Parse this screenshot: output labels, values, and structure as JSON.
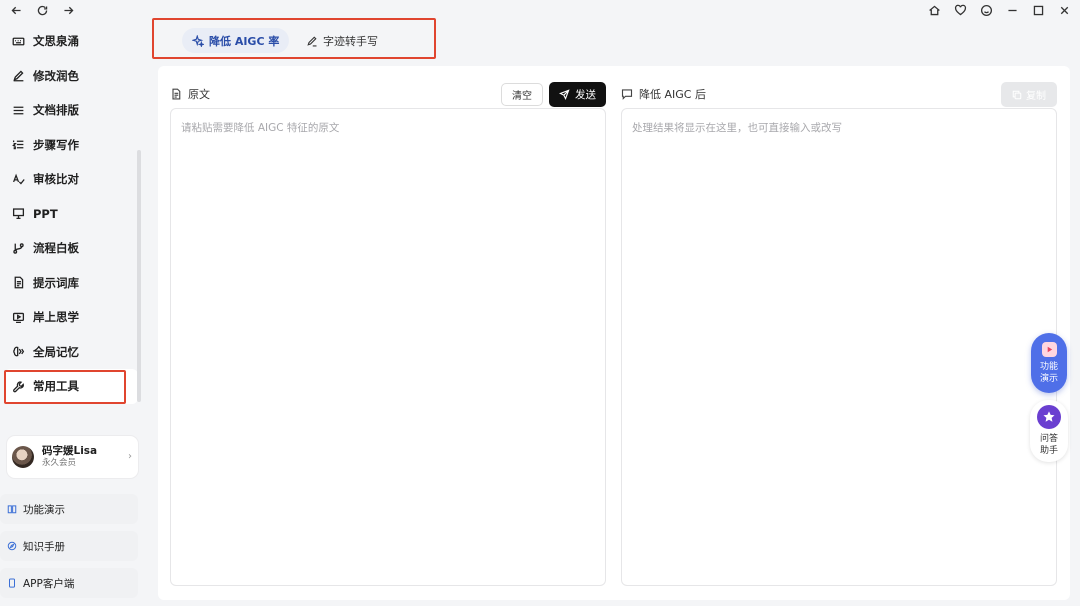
{
  "titlebar": {
    "icons": [
      "back-icon",
      "refresh-icon",
      "forward-icon",
      "home-icon",
      "heart-icon",
      "smile-icon",
      "minimize-icon",
      "maximize-icon",
      "close-icon"
    ]
  },
  "sidebar": {
    "items": [
      {
        "label": "文思泉涌",
        "icon": "keyboard-icon"
      },
      {
        "label": "修改润色",
        "icon": "pen-icon"
      },
      {
        "label": "文档排版",
        "icon": "menu-icon"
      },
      {
        "label": "步骤写作",
        "icon": "list-numbered-icon"
      },
      {
        "label": "审核比对",
        "icon": "spellcheck-icon"
      },
      {
        "label": "PPT",
        "icon": "presentation-icon"
      },
      {
        "label": "流程白板",
        "icon": "branch-icon"
      },
      {
        "label": "提示词库",
        "icon": "document-icon"
      },
      {
        "label": "岸上思学",
        "icon": "video-icon"
      },
      {
        "label": "全局记忆",
        "icon": "brain-icon"
      },
      {
        "label": "常用工具",
        "icon": "wrench-icon",
        "active": true
      }
    ],
    "user": {
      "name": "码字媛Lisa",
      "subtitle": "永久会员"
    },
    "bottom": [
      {
        "label": "功能演示",
        "icon": "book-icon"
      },
      {
        "label": "知识手册",
        "icon": "compass-icon"
      },
      {
        "label": "APP客户端",
        "icon": "phone-icon"
      }
    ]
  },
  "tabs": [
    {
      "label": "降低 AIGC 率",
      "icon": "sparkle-icon",
      "active": true
    },
    {
      "label": "字迹转手写",
      "icon": "pen-icon",
      "active": false
    }
  ],
  "left_pane": {
    "title": "原文",
    "clear_label": "清空",
    "send_label": "发送",
    "placeholder": "请粘贴需要降低 AIGC 特征的原文"
  },
  "right_pane": {
    "title": "降低 AIGC 后",
    "copy_label": "复制",
    "placeholder": "处理结果将显示在这里，也可直接输入或改写"
  },
  "floating": {
    "demo_label_1": "功能",
    "demo_label_2": "演示",
    "help_label_1": "问答",
    "help_label_2": "助手"
  }
}
